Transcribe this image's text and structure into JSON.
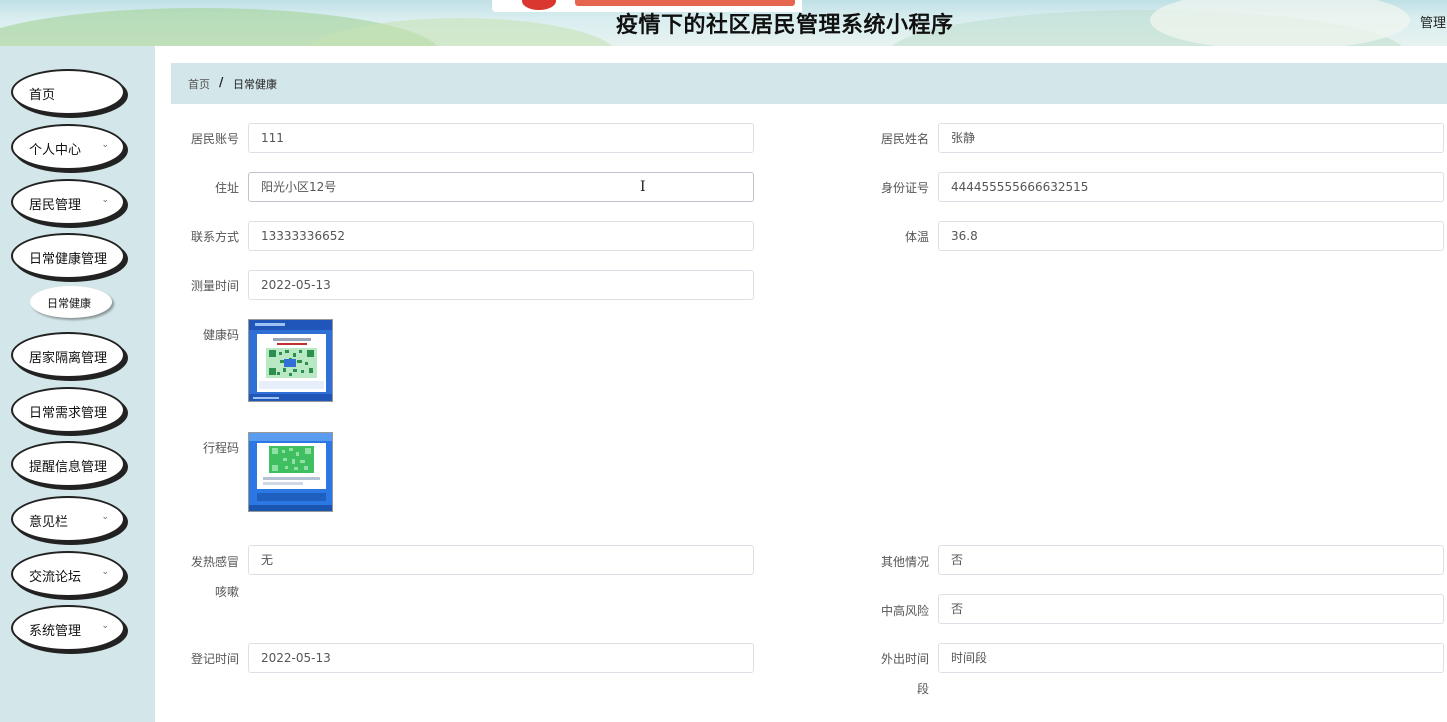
{
  "header": {
    "title": "疫情下的社区居民管理系统小程序",
    "admin_label": "管理"
  },
  "sidebar": {
    "items": [
      {
        "label": "首页",
        "has_submenu": false
      },
      {
        "label": "个人中心",
        "has_submenu": true
      },
      {
        "label": "居民管理",
        "has_submenu": true
      },
      {
        "label": "日常健康管理",
        "has_submenu": false
      },
      {
        "label": "居家隔离管理",
        "has_submenu": false
      },
      {
        "label": "日常需求管理",
        "has_submenu": false
      },
      {
        "label": "提醒信息管理",
        "has_submenu": false
      },
      {
        "label": "意见栏",
        "has_submenu": true
      },
      {
        "label": "交流论坛",
        "has_submenu": true
      },
      {
        "label": "系统管理",
        "has_submenu": true
      }
    ],
    "sub_item": "日常健康",
    "chevron": "⌄"
  },
  "breadcrumb": {
    "home": "首页",
    "separator": "/",
    "current": "日常健康"
  },
  "form": {
    "account_label": "居民账号",
    "account_value": "111",
    "name_label": "居民姓名",
    "name_value": "张静",
    "address_label": "住址",
    "address_value": "阳光小区12号",
    "id_label": "身份证号",
    "id_value": "444455555666632515",
    "phone_label": "联系方式",
    "phone_value": "13333336652",
    "temp_label": "体温",
    "temp_value": "36.8",
    "measure_time_label": "测量时间",
    "measure_time_value": "2022-05-13",
    "health_code_label": "健康码",
    "trip_code_label": "行程码",
    "fever_label_line1": "发热感冒",
    "fever_label_line2": "咳嗽",
    "fever_value": "无",
    "other_label": "其他情况",
    "other_value": "否",
    "risk_label": "中高风险",
    "risk_value": "否",
    "register_time_label": "登记时间",
    "register_time_value": "2022-05-13",
    "outing_label_line1": "外出时间",
    "outing_label_line2": "段",
    "outing_value": "时间段"
  },
  "colors": {
    "sidebar_bg": "#d3e6e9",
    "breadcrumb_bg": "#d3e6e9",
    "qr_blue": "#2f6fd6",
    "qr_green": "#3fbf5f"
  }
}
